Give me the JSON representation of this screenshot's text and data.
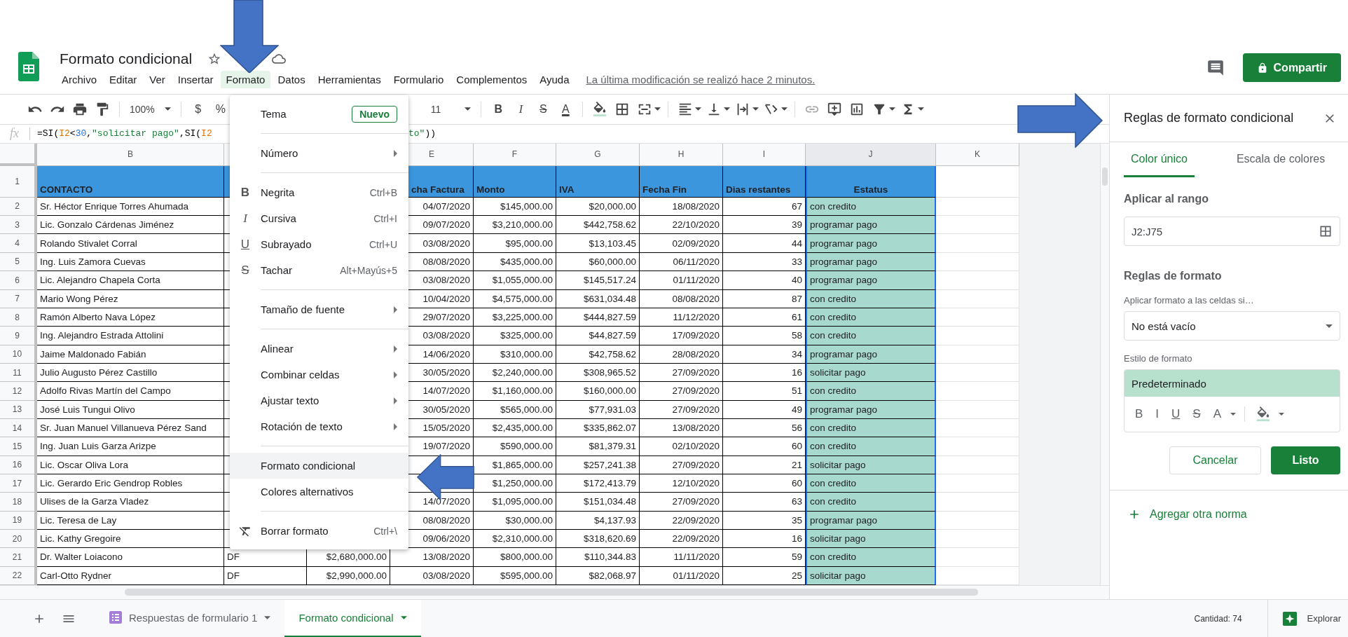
{
  "header": {
    "title": "Formato condicional",
    "menus": [
      {
        "label": "Archivo",
        "selected": false
      },
      {
        "label": "Editar",
        "selected": false
      },
      {
        "label": "Ver",
        "selected": false
      },
      {
        "label": "Insertar",
        "selected": false
      },
      {
        "label": "Formato",
        "selected": true
      },
      {
        "label": "Datos",
        "selected": false
      },
      {
        "label": "Herramientas",
        "selected": false
      },
      {
        "label": "Formulario",
        "selected": false
      },
      {
        "label": "Complementos",
        "selected": false
      },
      {
        "label": "Ayuda",
        "selected": false
      }
    ],
    "last_edit": "La última modificación se realizó hace 2 minutos.",
    "share_button": "Compartir"
  },
  "toolbar": {
    "zoom": "100%",
    "currency": "$",
    "percent": "%",
    "font_size": "11",
    "bold": "B",
    "italic": "I",
    "strike": "S",
    "text_color": "A"
  },
  "formula_bar": {
    "label": "fx",
    "tokens_start": [
      {
        "text": "=SI(",
        "kind": "plain"
      },
      {
        "text": "I2",
        "kind": "ref"
      },
      {
        "text": "<",
        "kind": "plain"
      },
      {
        "text": "30",
        "kind": "number"
      },
      {
        "text": ",",
        "kind": "plain"
      },
      {
        "text": "\"solicitar pago\"",
        "kind": "string"
      },
      {
        "text": ",SI(",
        "kind": "plain"
      },
      {
        "text": "I2",
        "kind": "ref"
      }
    ],
    "tokens_end": [
      {
        "text": "to\"",
        "kind": "string"
      },
      {
        "text": "))",
        "kind": "plain"
      }
    ]
  },
  "sheet": {
    "columns": [
      {
        "letter": "B",
        "selected": false
      },
      {
        "letter": "E",
        "selected": false
      },
      {
        "letter": "F",
        "selected": false
      },
      {
        "letter": "G",
        "selected": false
      },
      {
        "letter": "H",
        "selected": false
      },
      {
        "letter": "I",
        "selected": false
      },
      {
        "letter": "J",
        "selected": true
      },
      {
        "letter": "K",
        "selected": false
      }
    ],
    "header_row": {
      "number": "1",
      "contacto": "CONTACTO",
      "column_e": "cha Factura",
      "monto": "Monto",
      "iva": "IVA",
      "fecha_fin": "Fecha Fin",
      "dias_restantes": "Dias restantes",
      "estatus": "Estatus"
    },
    "rows": [
      {
        "number": "2",
        "contacto": "Sr. Héctor Enrique Torres Ahumada",
        "column_e": "04/07/2020",
        "monto": "$145,000.00",
        "iva": "$20,000.00",
        "fecha_fin": "18/08/2020",
        "dias_restantes": "67",
        "estatus": "con credito"
      },
      {
        "number": "3",
        "contacto": "Lic. Gonzalo Cárdenas Jiménez",
        "column_e": "09/07/2020",
        "monto": "$3,210,000.00",
        "iva": "$442,758.62",
        "fecha_fin": "22/10/2020",
        "dias_restantes": "39",
        "estatus": "programar pago"
      },
      {
        "number": "4",
        "contacto": "Rolando Stivalet Corral",
        "column_e": "03/08/2020",
        "monto": "$95,000.00",
        "iva": "$13,103.45",
        "fecha_fin": "02/09/2020",
        "dias_restantes": "44",
        "estatus": "programar pago"
      },
      {
        "number": "5",
        "contacto": "Ing. Luis Zamora Cuevas",
        "column_e": "08/08/2020",
        "monto": "$435,000.00",
        "iva": "$60,000.00",
        "fecha_fin": "06/11/2020",
        "dias_restantes": "33",
        "estatus": "programar pago"
      },
      {
        "number": "6",
        "contacto": "Lic. Alejandro Chapela Corta",
        "column_e": "03/08/2020",
        "monto": "$1,055,000.00",
        "iva": "$145,517.24",
        "fecha_fin": "01/11/2020",
        "dias_restantes": "40",
        "estatus": "programar pago"
      },
      {
        "number": "7",
        "contacto": "Mario Wong Pérez",
        "column_e": "10/04/2020",
        "monto": "$4,575,000.00",
        "iva": "$631,034.48",
        "fecha_fin": "08/08/2020",
        "dias_restantes": "87",
        "estatus": "con credito"
      },
      {
        "number": "8",
        "contacto": "Ramón Alberto Nava López",
        "column_e": "29/07/2020",
        "monto": "$3,225,000.00",
        "iva": "$444,827.59",
        "fecha_fin": "11/12/2020",
        "dias_restantes": "61",
        "estatus": "con credito"
      },
      {
        "number": "9",
        "contacto": "Ing. Alejandro Estrada Attolini",
        "column_e": "03/08/2020",
        "monto": "$325,000.00",
        "iva": "$44,827.59",
        "fecha_fin": "17/09/2020",
        "dias_restantes": "58",
        "estatus": "con credito"
      },
      {
        "number": "10",
        "contacto": "Jaime Maldonado Fabián",
        "column_e": "14/06/2020",
        "monto": "$310,000.00",
        "iva": "$42,758.62",
        "fecha_fin": "28/08/2020",
        "dias_restantes": "34",
        "estatus": "programar pago"
      },
      {
        "number": "11",
        "contacto": "Julio Augusto Pérez Castillo",
        "column_e": "30/05/2020",
        "monto": "$2,240,000.00",
        "iva": "$308,965.52",
        "fecha_fin": "27/09/2020",
        "dias_restantes": "16",
        "estatus": "solicitar pago"
      },
      {
        "number": "12",
        "contacto": "Adolfo Rivas Martín del Campo",
        "column_e": "14/07/2020",
        "monto": "$1,160,000.00",
        "iva": "$160,000.00",
        "fecha_fin": "27/09/2020",
        "dias_restantes": "51",
        "estatus": "con credito"
      },
      {
        "number": "13",
        "contacto": "José Luis Tungui Olivo",
        "column_e": "30/05/2020",
        "monto": "$565,000.00",
        "iva": "$77,931.03",
        "fecha_fin": "27/09/2020",
        "dias_restantes": "49",
        "estatus": "programar pago"
      },
      {
        "number": "14",
        "contacto": "Sr. Juan Manuel Villanueva Pérez Sand",
        "column_e": "15/05/2020",
        "monto": "$2,435,000.00",
        "iva": "$335,862.07",
        "fecha_fin": "13/08/2020",
        "dias_restantes": "56",
        "estatus": "con credito"
      },
      {
        "number": "15",
        "contacto": "Ing. Juan Luis Garza Arizpe",
        "column_e": "19/07/2020",
        "monto": "$590,000.00",
        "iva": "$81,379.31",
        "fecha_fin": "02/10/2020",
        "dias_restantes": "60",
        "estatus": "con credito"
      },
      {
        "number": "16",
        "contacto": "Lic. Oscar Oliva Lora",
        "monto": "$1,865,000.00",
        "iva": "$257,241.38",
        "fecha_fin": "27/09/2020",
        "dias_restantes": "21",
        "estatus": "solicitar pago"
      },
      {
        "number": "17",
        "contacto": "Lic. Gerardo Eric Gendrop Robles",
        "monto": "$1,250,000.00",
        "iva": "$172,413.79",
        "fecha_fin": "12/10/2020",
        "dias_restantes": "60",
        "estatus": "con credito"
      },
      {
        "number": "18",
        "contacto": "Ulises de la Garza Vladez",
        "column_e": "14/07/2020",
        "monto": "$1,095,000.00",
        "iva": "$151,034.48",
        "fecha_fin": "27/09/2020",
        "dias_restantes": "63",
        "estatus": "con credito"
      },
      {
        "number": "19",
        "contacto": "Lic. Teresa de Lay",
        "column_e": "08/08/2020",
        "monto": "$30,000.00",
        "iva": "$4,137.93",
        "fecha_fin": "22/09/2020",
        "dias_restantes": "35",
        "estatus": "programar pago"
      },
      {
        "number": "20",
        "contacto": "Lic. Kathy Gregoire",
        "column_e": "09/06/2020",
        "monto": "$2,310,000.00",
        "iva": "$318,620.69",
        "fecha_fin": "22/09/2020",
        "dias_restantes": "16",
        "estatus": "solicitar pago"
      },
      {
        "number": "21",
        "contacto": "Dr. Walter Loiacono",
        "column_c": "DF",
        "column_d": "$2,680,000.00",
        "column_e": "13/08/2020",
        "monto": "$800,000.00",
        "iva": "$110,344.83",
        "fecha_fin": "11/11/2020",
        "dias_restantes": "59",
        "estatus": "con credito"
      },
      {
        "number": "22",
        "contacto": "Carl-Otto Rydner",
        "column_c": "DF",
        "column_d": "$2,990,000.00",
        "column_e": "03/08/2020",
        "monto": "$595,000.00",
        "iva": "$82,068.97",
        "fecha_fin": "01/11/2020",
        "dias_restantes": "25",
        "estatus": "solicitar pago"
      }
    ]
  },
  "format_menu": {
    "items": [
      {
        "kind": "item",
        "label": "Tema",
        "badge": "Nuevo",
        "submenu": false,
        "selected": false
      },
      {
        "kind": "divider"
      },
      {
        "kind": "item",
        "label": "Número",
        "submenu": true,
        "selected": false
      },
      {
        "kind": "divider"
      },
      {
        "kind": "bold",
        "glyph": "B",
        "label": "Negrita",
        "shortcut": "Ctrl+B",
        "submenu": false,
        "selected": false
      },
      {
        "kind": "italic",
        "glyph": "I",
        "label": "Cursiva",
        "shortcut": "Ctrl+I",
        "submenu": false,
        "selected": false
      },
      {
        "kind": "underline",
        "glyph": "U",
        "label": "Subrayado",
        "shortcut": "Ctrl+U",
        "submenu": false,
        "selected": false
      },
      {
        "kind": "strike",
        "glyph": "S",
        "label": "Tachar",
        "shortcut": "Alt+Mayús+5",
        "submenu": false,
        "selected": false
      },
      {
        "kind": "divider"
      },
      {
        "kind": "item",
        "label": "Tamaño de fuente",
        "submenu": true,
        "selected": false
      },
      {
        "kind": "divider"
      },
      {
        "kind": "item",
        "label": "Alinear",
        "submenu": true,
        "selected": false
      },
      {
        "kind": "item",
        "label": "Combinar celdas",
        "submenu": true,
        "selected": false
      },
      {
        "kind": "item",
        "label": "Ajustar texto",
        "submenu": true,
        "selected": false
      },
      {
        "kind": "item",
        "label": "Rotación de texto",
        "submenu": true,
        "selected": false
      },
      {
        "kind": "divider"
      },
      {
        "kind": "item",
        "label": "Formato condicional",
        "submenu": false,
        "selected": true
      },
      {
        "kind": "item",
        "label": "Colores alternativos",
        "submenu": false,
        "selected": false
      },
      {
        "kind": "divider"
      },
      {
        "kind": "clear",
        "label": "Borrar formato",
        "shortcut": "Ctrl+\\",
        "submenu": false,
        "selected": false
      }
    ]
  },
  "panel": {
    "title": "Reglas de formato condicional",
    "tabs": [
      {
        "label": "Color único",
        "selected": true
      },
      {
        "label": "Escala de colores",
        "selected": false
      }
    ],
    "range_label": "Aplicar al rango",
    "range_value": "J2:J75",
    "rules_heading": "Reglas de formato",
    "condition_label": "Aplicar formato a las celdas si…",
    "condition_value": "No está vacío",
    "style_label": "Estilo de formato",
    "style_preview": "Predeterminado",
    "style_tools": {
      "bold": "B",
      "italic": "I",
      "underline": "U",
      "strike": "S",
      "text_color": "A"
    },
    "cancel_button": "Cancelar",
    "done_button": "Listo",
    "add_rule_link": "Agregar otra norma"
  },
  "bottom_bar": {
    "sheet_tabs": [
      {
        "label": "Respuestas de formulario 1",
        "kind": "form",
        "selected": false
      },
      {
        "label": "Formato condicional",
        "kind": "sheet",
        "selected": true
      }
    ],
    "count": "Cantidad: 74",
    "explore_button": "Explorar"
  }
}
